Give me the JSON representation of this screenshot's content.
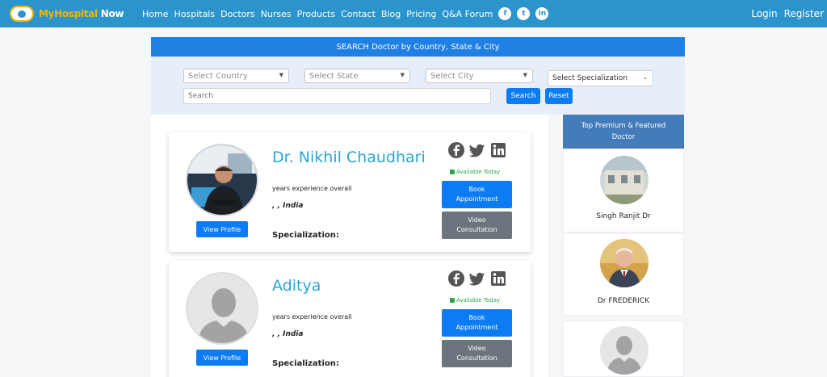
{
  "navbar": {
    "logo_prefix": "My",
    "logo_main": "Hospital",
    "logo_suffix": " Now",
    "links": [
      "Home",
      "Hospitals",
      "Doctors",
      "Nurses",
      "Products",
      "Contact",
      "Blog",
      "Pricing",
      "Q&A Forum"
    ],
    "social_icons": [
      "facebook-icon",
      "twitter-icon",
      "linkedin-icon"
    ],
    "login": "Login",
    "register": "Register"
  },
  "search": {
    "header": "SEARCH Doctor by Country, State & City",
    "country_placeholder": "Select Country",
    "state_placeholder": "Select State",
    "city_placeholder": "Select City",
    "specialization_value": "Select Specialization",
    "search_placeholder": "Search",
    "search_button": "Search",
    "reset_button": "Reset"
  },
  "doctors": [
    {
      "name": "Dr. Nikhil Chaudhari",
      "experience": "years experience overall",
      "location": ", , India",
      "specialization_label": "Specialization:",
      "availability": "Available Today",
      "book_label": "Book Appointment",
      "video_label": "Video Consultation",
      "view_label": "View Profile"
    },
    {
      "name": "Aditya",
      "experience": "years experience overall",
      "location": ", , India",
      "specialization_label": "Specialization:",
      "availability": "Available Today",
      "book_label": "Book Appointment",
      "video_label": "Video Consultation",
      "view_label": "View Profile"
    }
  ],
  "sidebar": {
    "header": "Top Premium & Featured Doctor",
    "doctors": [
      {
        "name": "Singh Ranjit Dr"
      },
      {
        "name": "Dr FREDERICK"
      },
      {
        "name": ""
      }
    ]
  },
  "colors": {
    "navbar": "#2c94cc",
    "primary": "#0d7bf2",
    "secondary": "#6c757d",
    "doctor_name": "#2aa5d6",
    "available": "#28a745",
    "sidebar_header": "#447cba"
  }
}
